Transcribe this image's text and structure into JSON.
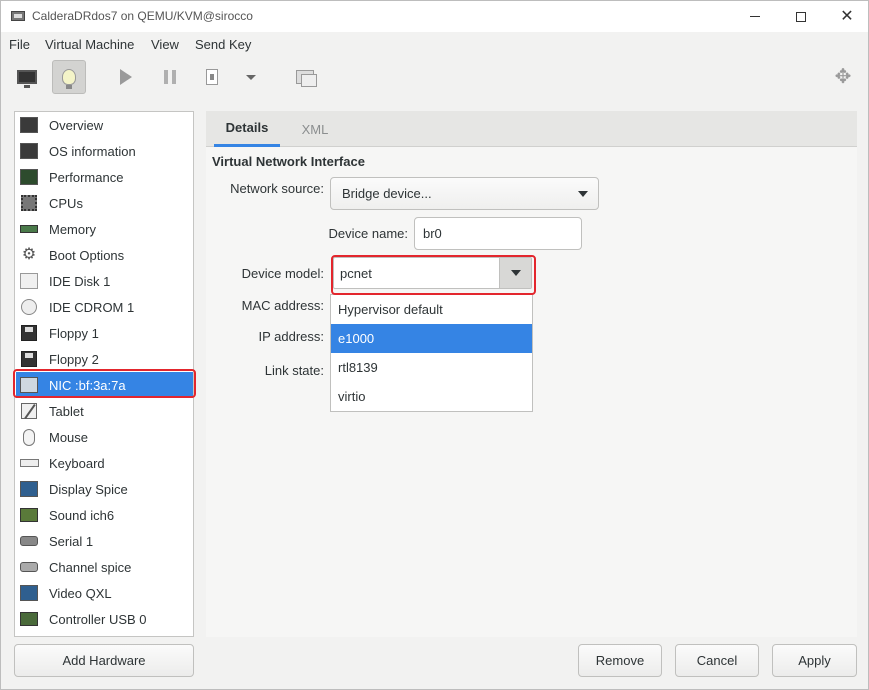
{
  "window": {
    "title": "CalderaDRdos7 on QEMU/KVM@sirocco"
  },
  "menubar": {
    "items": [
      "File",
      "Virtual Machine",
      "View",
      "Send Key"
    ]
  },
  "sidebar": {
    "items": [
      {
        "label": "Overview",
        "icon": "overview-monitor-icon"
      },
      {
        "label": "OS information",
        "icon": "os-monitor-icon"
      },
      {
        "label": "Performance",
        "icon": "performance-graph-icon"
      },
      {
        "label": "CPUs",
        "icon": "cpu-chip-icon"
      },
      {
        "label": "Memory",
        "icon": "memory-ram-icon"
      },
      {
        "label": "Boot Options",
        "icon": "boot-gear-icon"
      },
      {
        "label": "IDE Disk 1",
        "icon": "hard-disk-icon"
      },
      {
        "label": "IDE CDROM 1",
        "icon": "cdrom-icon"
      },
      {
        "label": "Floppy 1",
        "icon": "floppy-icon"
      },
      {
        "label": "Floppy 2",
        "icon": "floppy-icon"
      },
      {
        "label": "NIC :bf:3a:7a",
        "icon": "network-card-icon",
        "selected": true
      },
      {
        "label": "Tablet",
        "icon": "tablet-pen-icon"
      },
      {
        "label": "Mouse",
        "icon": "mouse-icon"
      },
      {
        "label": "Keyboard",
        "icon": "keyboard-icon"
      },
      {
        "label": "Display Spice",
        "icon": "display-monitor-icon"
      },
      {
        "label": "Sound ich6",
        "icon": "sound-card-icon"
      },
      {
        "label": "Serial 1",
        "icon": "serial-port-icon"
      },
      {
        "label": "Channel spice",
        "icon": "channel-icon"
      },
      {
        "label": "Video QXL",
        "icon": "video-monitor-icon"
      },
      {
        "label": "Controller USB 0",
        "icon": "pci-controller-icon"
      }
    ],
    "add_hardware_label": "Add Hardware"
  },
  "tabs": [
    {
      "label": "Details",
      "active": true
    },
    {
      "label": "XML",
      "active": false
    }
  ],
  "details": {
    "section_title": "Virtual Network Interface",
    "network_source_label": "Network source:",
    "network_source_value": "Bridge device...",
    "device_name_label": "Device name:",
    "device_name_value": "br0",
    "device_model_label": "Device model:",
    "device_model_value": "pcnet",
    "mac_address_label": "MAC address:",
    "ip_address_label": "IP address:",
    "link_state_label": "Link state:"
  },
  "model_dropdown": {
    "options": [
      "Hypervisor default",
      "e1000",
      "rtl8139",
      "virtio"
    ],
    "highlighted_index": 1
  },
  "buttons": {
    "remove": "Remove",
    "cancel": "Cancel",
    "apply": "Apply"
  },
  "colors": {
    "selection": "#3584e4",
    "highlight_outline": "#e3262d"
  }
}
